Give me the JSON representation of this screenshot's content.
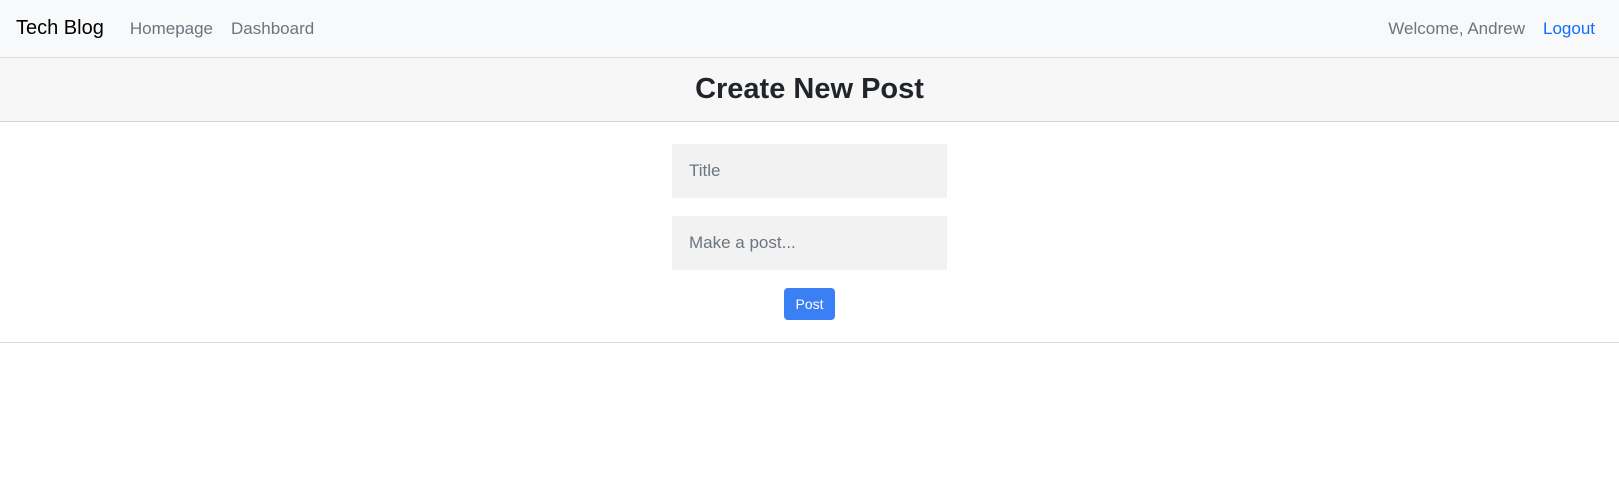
{
  "nav": {
    "brand": "Tech Blog",
    "links": [
      {
        "label": "Homepage"
      },
      {
        "label": "Dashboard"
      }
    ],
    "welcome": "Welcome, Andrew",
    "logout": "Logout"
  },
  "post_form": {
    "header": "Create New Post",
    "title_placeholder": "Title",
    "title_value": "",
    "body_placeholder": "Make a post...",
    "body_value": "",
    "submit_label": "Post"
  },
  "colors": {
    "accent": "#3b7ff5",
    "link": "#0d6efd",
    "navbar_bg": "#f8f9fa"
  }
}
